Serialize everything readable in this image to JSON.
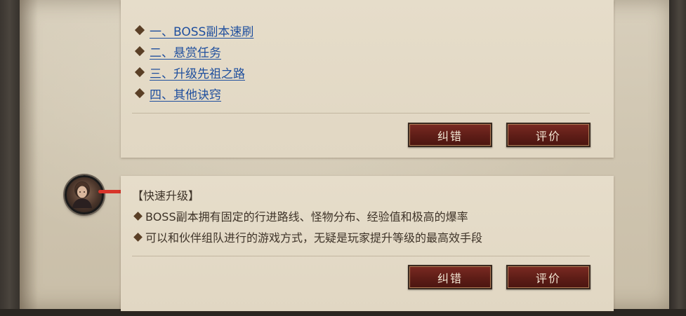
{
  "card1": {
    "links": [
      {
        "label": "一、BOSS副本速刷"
      },
      {
        "label": "二、悬赏任务"
      },
      {
        "label": "三、升级先祖之路"
      },
      {
        "label": "四、其他诀窍"
      }
    ],
    "buttons": {
      "correct": "纠错",
      "rate": "评价"
    }
  },
  "card2": {
    "heading": "【快速升级】",
    "lines": [
      "BOSS副本拥有固定的行进路线、怪物分布、经验值和极高的爆率",
      "可以和伙伴组队进行的游戏方式，无疑是玩家提升等级的最高效手段"
    ],
    "buttons": {
      "correct": "纠错",
      "rate": "评价"
    }
  },
  "colors": {
    "link": "#1f4f9e",
    "button": "#5e1d17",
    "parchment": "#d8cfbc",
    "marker": "#d8342a"
  },
  "icons": [
    "diamond-bullet-icon",
    "character-avatar-icon"
  ]
}
